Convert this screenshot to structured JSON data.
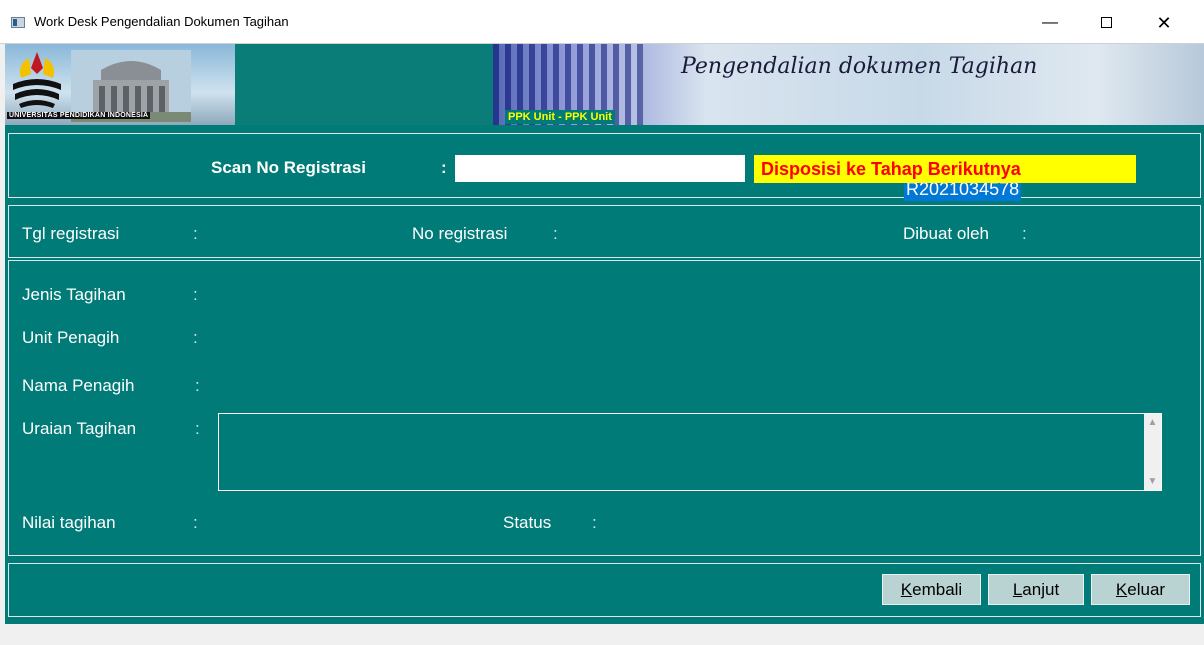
{
  "window": {
    "title": "Work Desk Pengendalian Dokumen Tagihan",
    "min_icon": "minimize-icon",
    "max_icon": "maximize-icon",
    "close_glyph": "✕"
  },
  "banner": {
    "university": "UNIVERSITAS PENDIDIKAN INDONESIA",
    "unit_tag": "PPK Unit - PPK Unit",
    "slogan": "Pengendalian dokumen Tagihan"
  },
  "scan": {
    "label": "Scan No Registrasi",
    "colon": ":",
    "value": "R2021034578",
    "disposition": "Disposisi ke Tahap Berikutnya"
  },
  "registration": {
    "date_label": "Tgl registrasi",
    "number_label": "No registrasi",
    "creator_label": "Dibuat oleh",
    "colon": ":"
  },
  "details": {
    "jenis_label": "Jenis Tagihan",
    "unit_label": "Unit Penagih",
    "nama_label": "Nama Penagih",
    "uraian_label": "Uraian Tagihan",
    "nilai_label": "Nilai tagihan",
    "status_label": "Status",
    "colon": ":"
  },
  "buttons": {
    "back": {
      "prefix": "",
      "accel": "K",
      "rest": "embali"
    },
    "next": {
      "prefix": "",
      "accel": "L",
      "rest": "anjut"
    },
    "exit": {
      "prefix": "",
      "accel": "K",
      "rest": "eluar"
    }
  },
  "colors": {
    "background": "#007b77",
    "highlight_bg": "#ffff00",
    "highlight_text": "#ff0000",
    "selection": "#0078d7"
  }
}
